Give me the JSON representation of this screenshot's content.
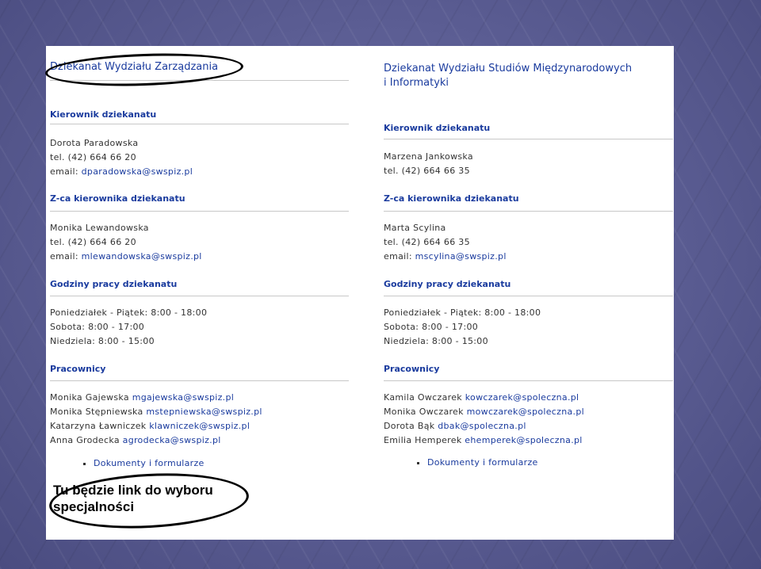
{
  "left": {
    "title": "Dziekanat Wydziału Zarządzania",
    "head_manager": "Kierownik dziekanatu",
    "manager_name": "Dorota Paradowska",
    "manager_tel": "tel. (42) 664 66 20",
    "manager_email_label": "email:",
    "manager_email": "dparadowska@swspiz.pl",
    "head_deputy": "Z-ca kierownika dziekanatu",
    "deputy_name": "Monika Lewandowska",
    "deputy_tel": "tel. (42) 664 66 20",
    "deputy_email_label": "email:",
    "deputy_email": "mlewandowska@swspiz.pl",
    "head_hours": "Godziny pracy dziekanatu",
    "hours": [
      "Poniedziałek - Piątek: 8:00 - 18:00",
      "Sobota: 8:00 - 17:00",
      "Niedziela: 8:00 - 15:00"
    ],
    "head_staff": "Pracownicy",
    "staff": [
      {
        "name": "Monika Gajewska",
        "email": "mgajewska@swspiz.pl"
      },
      {
        "name": "Monika Stępniewska",
        "email": "mstepniewska@swspiz.pl"
      },
      {
        "name": "Katarzyna Ławniczek",
        "email": "klawniczek@swspiz.pl"
      },
      {
        "name": "Anna Grodecka",
        "email": "agrodecka@swspiz.pl"
      }
    ],
    "docs_link": "Dokumenty i formularze"
  },
  "right": {
    "title_line1": "Dziekanat Wydziału Studiów Międzynarodowych",
    "title_line2": "i Informatyki",
    "head_manager": "Kierownik dziekanatu",
    "manager_name": "Marzena Jankowska",
    "manager_tel": "tel. (42) 664 66 35",
    "head_deputy": "Z-ca kierownika dziekanatu",
    "deputy_name": "Marta Scylina",
    "deputy_tel": "tel. (42) 664 66 35",
    "deputy_email_label": "email:",
    "deputy_email": "mscylina@swspiz.pl",
    "head_hours": "Godziny pracy dziekanatu",
    "hours": [
      "Poniedziałek - Piątek: 8:00 - 18:00",
      "Sobota: 8:00 - 17:00",
      "Niedziela: 8:00 - 15:00"
    ],
    "head_staff": "Pracownicy",
    "staff": [
      {
        "name": "Kamila Owczarek",
        "email": "kowczarek@spoleczna.pl"
      },
      {
        "name": "Monika Owczarek",
        "email": "mowczarek@spoleczna.pl"
      },
      {
        "name": "Dorota Bąk",
        "email": "dbak@spoleczna.pl"
      },
      {
        "name": "Emilia Hemperek",
        "email": "ehemperek@spoleczna.pl"
      }
    ],
    "docs_link": "Dokumenty i formularze"
  },
  "annotation": {
    "note_line1": "Tu będzie link do wyboru",
    "note_line2": "specjalności"
  },
  "colors": {
    "heading": "#1a3b9e",
    "text": "#333333",
    "background": "#5b5d94"
  }
}
